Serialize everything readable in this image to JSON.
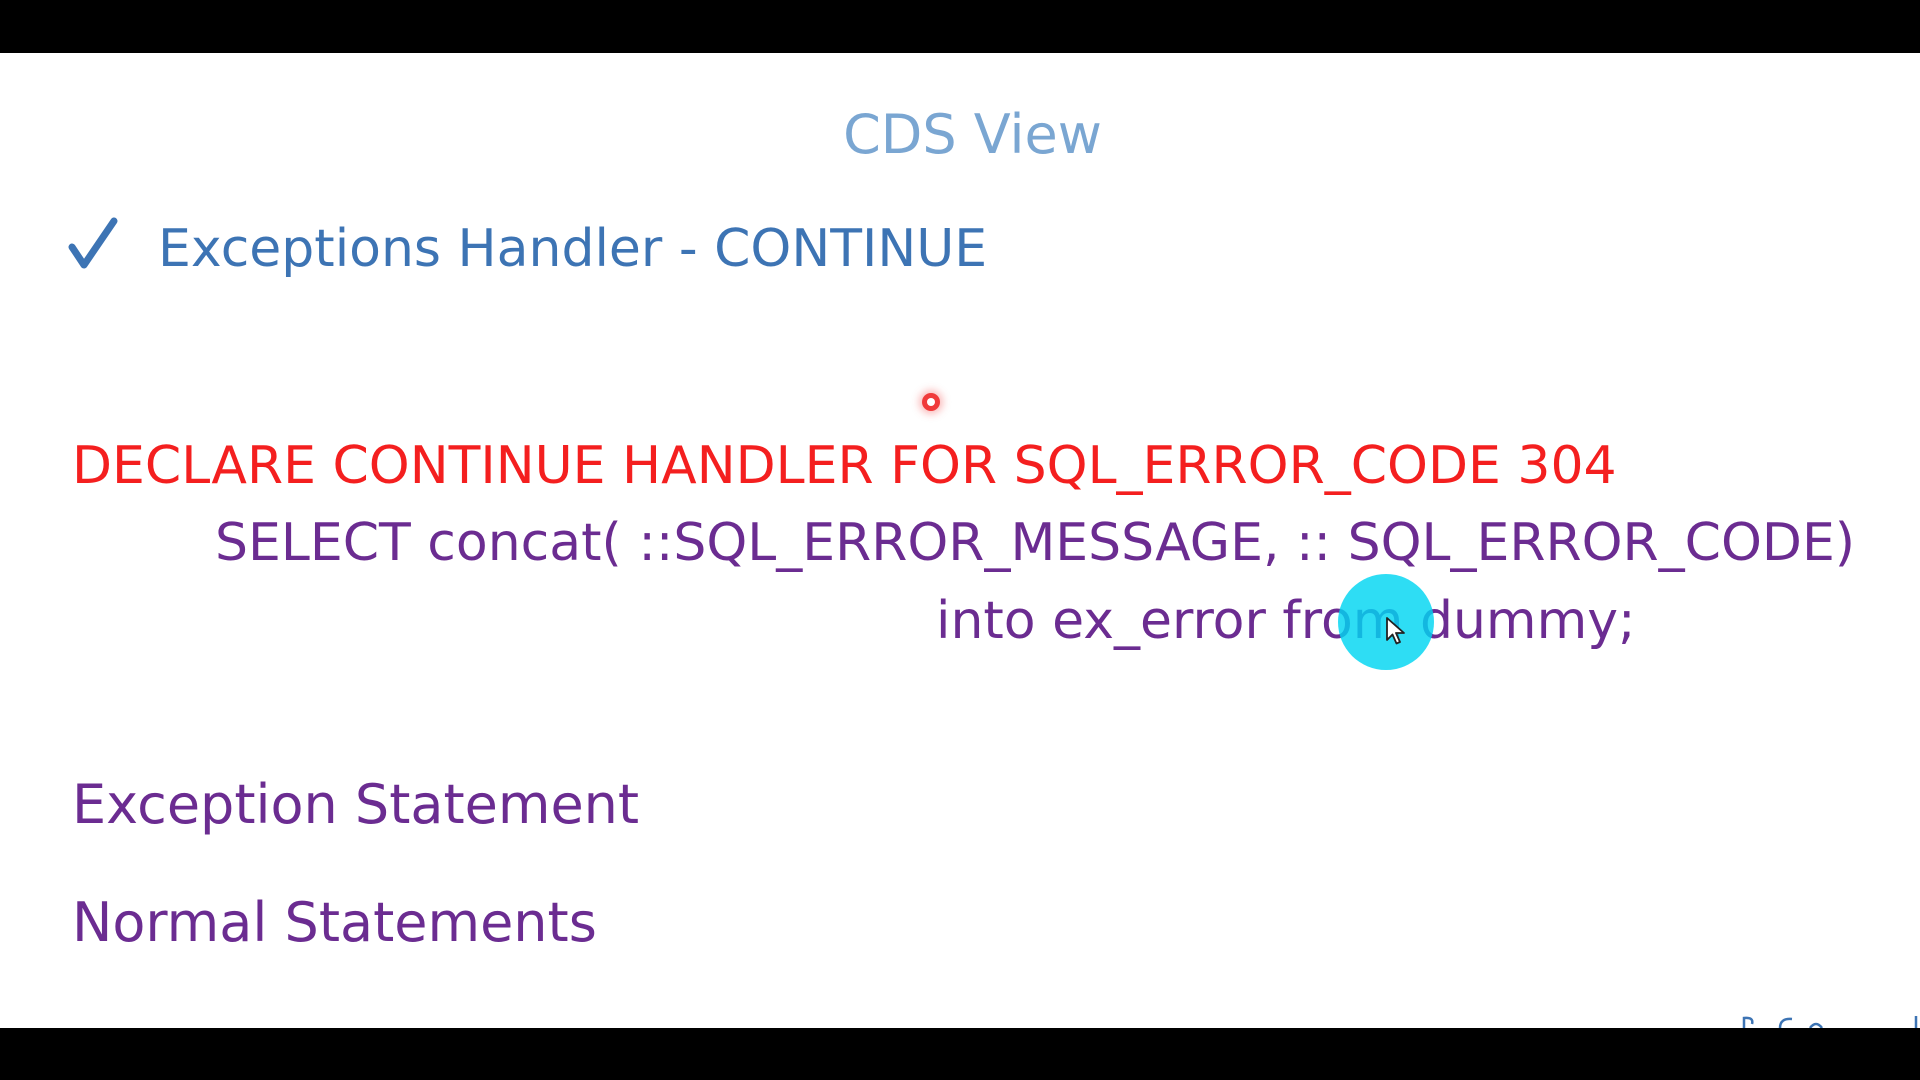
{
  "slide": {
    "title": "CDS View",
    "bullet": "Exceptions Handler - CONTINUE",
    "code": {
      "declare_line": "DECLARE CONTINUE HANDLER FOR SQL_ERROR_CODE 304",
      "select_line": "SELECT concat( ::SQL_ERROR_MESSAGE, :: SQL_ERROR_CODE)",
      "into_line": "into ex_error from dummy;"
    },
    "labels": {
      "exception_statement": "Exception Statement",
      "normal_statements": "Normal Statements"
    }
  },
  "icons": {
    "bullet": "checkmark-icon",
    "pointer": "mouse-pointer-icon",
    "recording": "record-indicator-icon"
  },
  "colors": {
    "title": "#7aa6d2",
    "bullet": "#3d74b4",
    "declare": "#f41f1f",
    "statements": "#6b2c91",
    "cursor_highlight": "#00d6f2"
  }
}
